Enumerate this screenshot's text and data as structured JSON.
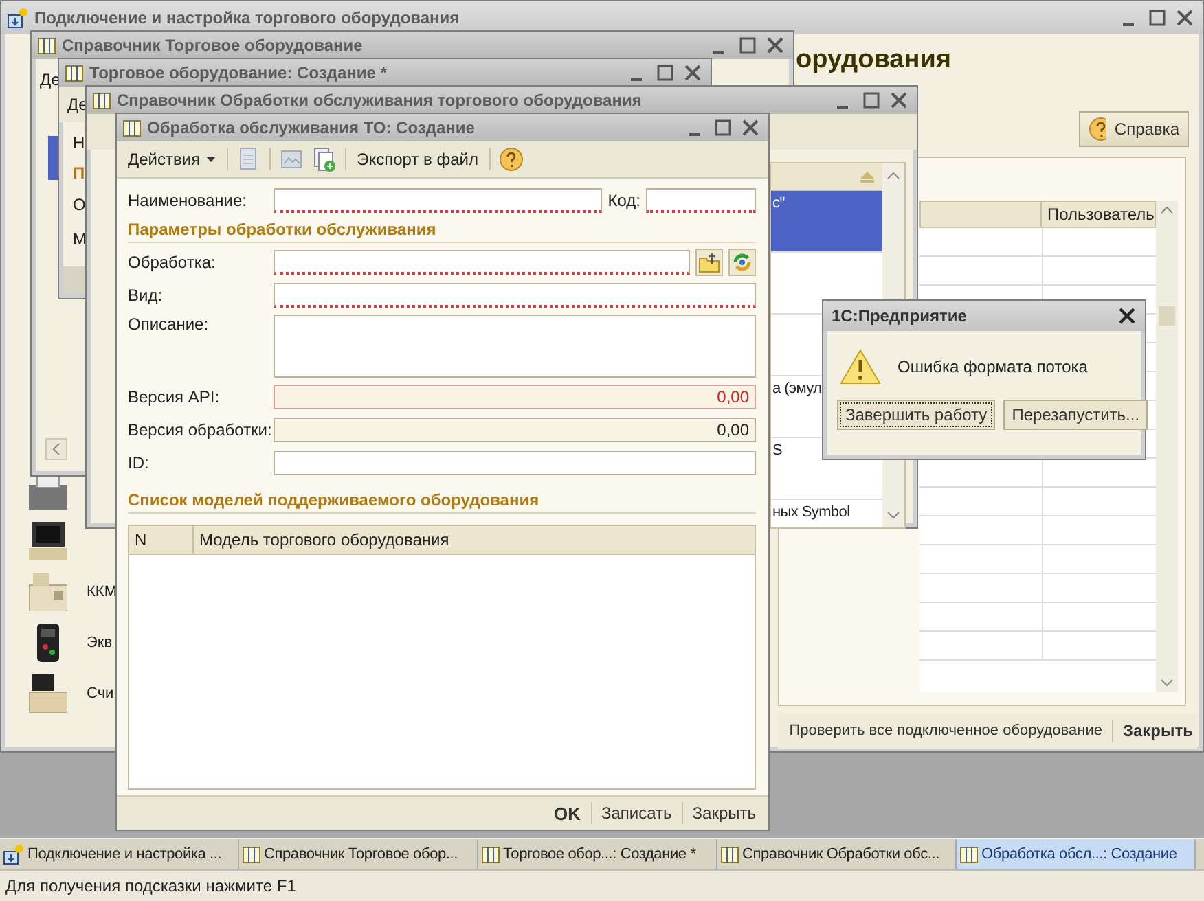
{
  "desktop_window": {
    "title": "Подключение и настройка торгового оборудования",
    "heading": "орудования",
    "help_button": "Справка",
    "table": {
      "columns": [
        "Пользователь"
      ]
    },
    "devices": [
      {
        "kind": "receipt-printer"
      },
      {
        "kind": "pos-terminal"
      },
      {
        "kind": "cash-register",
        "label": "ККМ"
      },
      {
        "kind": "card-terminal",
        "label": "Экв"
      },
      {
        "kind": "scanner",
        "label": "Счи"
      }
    ],
    "footer_buttons": [
      {
        "label": "Проверить все подключенное оборудование",
        "default": false
      },
      {
        "label": "Закрыть",
        "default": true
      }
    ]
  },
  "catalog_window": {
    "title": "Справочник Торговое оборудование",
    "toolbar_fragment": "Де"
  },
  "item_window": {
    "title": "Торговое оборудование: Создание *",
    "toolbar_fragment": "Де",
    "label_fragments": [
      {
        "text": "Н",
        "kind": "label"
      },
      {
        "text": "П",
        "kind": "section"
      },
      {
        "text": "О",
        "kind": "label"
      },
      {
        "text": "М",
        "kind": "label"
      }
    ]
  },
  "processors_window": {
    "title": "Справочник Обработки обслуживания торгового оборудования",
    "rows": [
      {
        "text": "с\"",
        "selected": true
      },
      {
        "selected": false
      },
      {
        "selected": false
      },
      {
        "text": "а (эмул",
        "selected": false
      },
      {
        "text": "S",
        "selected": false
      },
      {
        "text": "ных Symbol",
        "selected": false
      }
    ]
  },
  "form_window": {
    "title": "Обработка обслуживания ТО: Создание",
    "toolbar": {
      "actions": "Действия",
      "export": "Экспорт в файл"
    },
    "name_field": {
      "label": "Наименование:",
      "required": true
    },
    "code_field": {
      "label": "Код:",
      "required": true
    },
    "params_section": "Параметры обработки обслуживания",
    "fields": [
      {
        "label": "Обработка:",
        "kind": "file",
        "required": true,
        "invalid": false
      },
      {
        "label": "Вид:",
        "kind": "text",
        "required": true,
        "invalid": false
      },
      {
        "label": "Описание:",
        "kind": "multiline",
        "required": false,
        "invalid": false
      },
      {
        "label": "Версия API:",
        "kind": "number",
        "value": "0,00",
        "required": false,
        "invalid": true
      },
      {
        "label": "Версия обработки:",
        "kind": "number",
        "value": "0,00",
        "required": false,
        "invalid": false
      },
      {
        "label": "ID:",
        "kind": "text",
        "required": false,
        "invalid": false
      }
    ],
    "models_section": "Список моделей поддерживаемого оборудования",
    "models_table": {
      "columns": [
        "N",
        "Модель торгового оборудования"
      ]
    },
    "buttons": [
      {
        "label": "OK",
        "default": true
      },
      {
        "label": "Записать",
        "default": false
      },
      {
        "label": "Закрыть",
        "default": false
      }
    ]
  },
  "dialog": {
    "title": "1С:Предприятие",
    "message": "Ошибка формата потока",
    "buttons": [
      {
        "label": "Завершить работу",
        "focused": true
      },
      {
        "label": "Перезапустить...",
        "focused": false
      }
    ]
  },
  "taskbar": [
    {
      "label": "Подключение и настройка ...",
      "kind": "setup",
      "selected": false
    },
    {
      "label": "Справочник Торговое обор...",
      "kind": "catalog",
      "selected": false
    },
    {
      "label": "Торговое обор...: Создание *",
      "kind": "catalog",
      "selected": false
    },
    {
      "label": "Справочник Обработки обс...",
      "kind": "catalog",
      "selected": false
    },
    {
      "label": "Обработка обсл...: Создание",
      "kind": "catalog",
      "selected": true
    }
  ],
  "status_bar": "Для получения подсказки нажмите F1"
}
